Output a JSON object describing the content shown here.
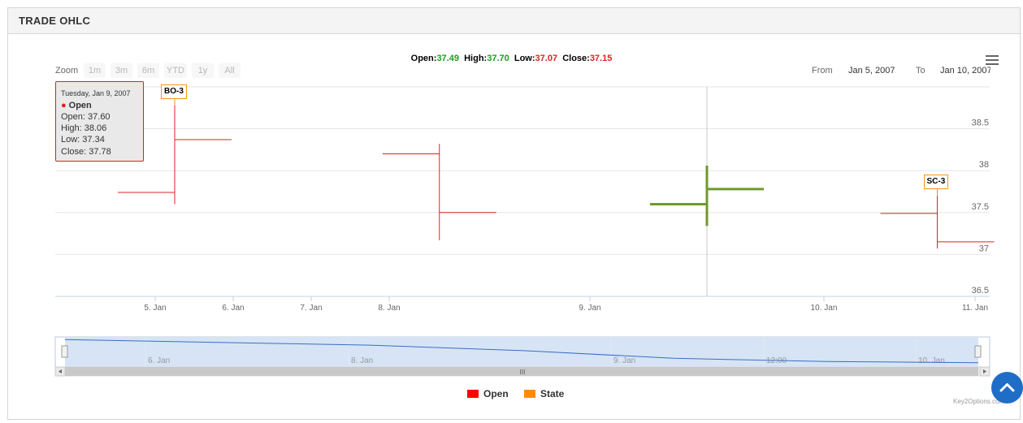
{
  "panel": {
    "title": "TRADE OHLC"
  },
  "header_ohlc": {
    "open_label": "Open:",
    "open_value": "37.49",
    "high_label": "High:",
    "high_value": "37.70",
    "low_label": "Low:",
    "low_value": "37.07",
    "close_label": "Close:",
    "close_value": "37.15"
  },
  "zoom": {
    "label": "Zoom",
    "buttons": [
      "1m",
      "3m",
      "6m",
      "YTD",
      "1y",
      "All"
    ]
  },
  "range": {
    "from_label": "From",
    "from_value": "Jan 5, 2007",
    "to_label": "To",
    "to_value": "Jan 10, 2007"
  },
  "tooltip": {
    "date": "Tuesday, Jan 9, 2007",
    "series": "Open",
    "open": "Open: 37.60",
    "high": "High: 38.06",
    "low": "Low: 37.34",
    "close": "Close: 37.78"
  },
  "flags": [
    {
      "text": "BO-3"
    },
    {
      "text": "SC-3"
    }
  ],
  "navigator": {
    "labels": [
      "6. Jan",
      "8. Jan",
      "9. Jan",
      "12:00",
      "10. Jan"
    ],
    "scroll_grip": "III"
  },
  "legend": [
    {
      "name": "Open",
      "color": "#ff0000"
    },
    {
      "name": "State",
      "color": "#ff8c00"
    }
  ],
  "credit": "Key2Options.com",
  "colors": {
    "down": "#e02020",
    "up": "#6f9a2e",
    "flag_border": "#f7941d",
    "navigator_fill": "#d6e4f5",
    "navigator_line": "#3a6fc2",
    "fab": "#1e6ec8"
  },
  "icons": {
    "menu": "hamburger-menu-icon",
    "scroll_up": "chevron-up-icon"
  },
  "chart_data": {
    "type": "ohlc",
    "x_tick_labels": [
      "5. Jan",
      "6. Jan",
      "7. Jan",
      "8. Jan",
      "9. Jan",
      "10. Jan",
      "11. Jan"
    ],
    "y_ticks": [
      36.5,
      37,
      37.5,
      38,
      38.5
    ],
    "y_tick_labels": [
      "36.5",
      "37",
      "37.5",
      "38",
      "38.5"
    ],
    "ylim": [
      36.5,
      39.0
    ],
    "grid": true,
    "crosshair_x": "2007-01-09T12:00",
    "bars": [
      {
        "x": "2007-01-05T06:00",
        "open": 37.74,
        "high": 38.9,
        "low": 37.6,
        "close": 38.37,
        "color": "down"
      },
      {
        "x": "2007-01-08T06:00",
        "open": 38.2,
        "high": 38.32,
        "low": 37.17,
        "close": 37.5,
        "color": "down"
      },
      {
        "x": "2007-01-09T12:00",
        "open": 37.6,
        "high": 38.06,
        "low": 37.34,
        "close": 37.78,
        "color": "up"
      },
      {
        "x": "2007-01-10T18:00",
        "open": 37.49,
        "high": 37.7,
        "low": 37.07,
        "close": 37.15,
        "color": "down"
      }
    ],
    "flags": [
      {
        "x": "2007-01-05T06:00",
        "title": "BO-3",
        "series": "State"
      },
      {
        "x": "2007-01-10T18:00",
        "title": "SC-3",
        "series": "State"
      }
    ],
    "navigator_series": [
      {
        "x": "2007-01-05",
        "y": 38.2
      },
      {
        "x": "2007-01-07",
        "y": 37.95
      },
      {
        "x": "2007-01-08",
        "y": 37.7
      },
      {
        "x": "2007-01-09",
        "y": 37.35
      },
      {
        "x": "2007-01-10",
        "y": 37.2
      },
      {
        "x": "2007-01-11",
        "y": 37.15
      }
    ],
    "legend": [
      "Open",
      "State"
    ],
    "legend_position": "bottom-center"
  }
}
